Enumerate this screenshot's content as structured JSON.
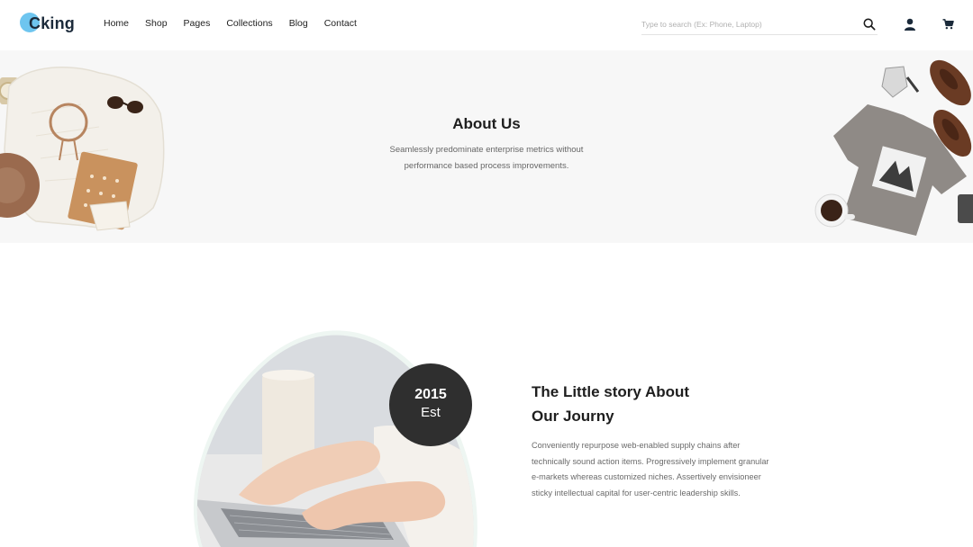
{
  "brand": {
    "logo_text": "Cking"
  },
  "nav": {
    "items": [
      "Home",
      "Shop",
      "Pages",
      "Collections",
      "Blog",
      "Contact"
    ]
  },
  "search": {
    "placeholder": "Type to search (Ex: Phone, Laptop)"
  },
  "icons": {
    "search": "search-icon",
    "user": "user-icon",
    "cart": "cart-icon"
  },
  "hero": {
    "title": "About Us",
    "subtitle_line1": "Seamlessly predominate enterprise metrics without",
    "subtitle_line2": "performance based process improvements."
  },
  "story": {
    "badge_year": "2015",
    "badge_label": "Est",
    "title_line1": "The Little story About",
    "title_line2": "Our Journy",
    "text_lines": [
      "Conveniently repurpose web-enabled supply chains after",
      "technically sound action items. Progressively implement granular",
      "e-markets whereas customized niches. Assertively envisioneer",
      "sticky intellectual capital for user-centric leadership skills."
    ]
  },
  "colors": {
    "accent": "#6ec5ef",
    "badge_bg": "#2f2f2f",
    "hero_bg": "#f7f7f7"
  }
}
